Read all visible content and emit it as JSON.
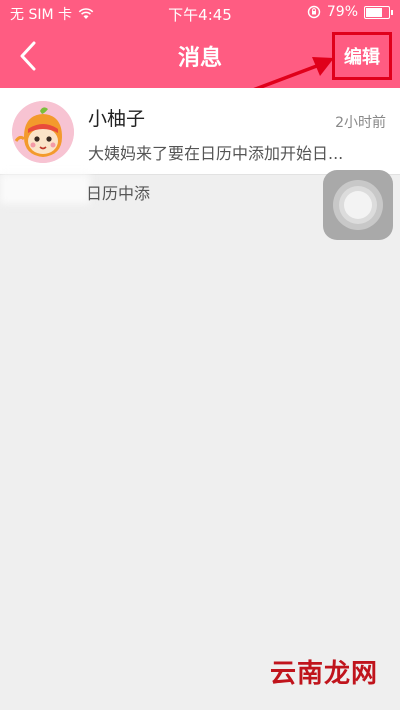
{
  "status_bar": {
    "carrier": "无 SIM 卡",
    "time": "下午4:45",
    "battery_percent": "79%",
    "battery_level": 0.79,
    "icons": [
      "wifi-icon",
      "lock-rotation-icon",
      "battery-icon"
    ]
  },
  "nav": {
    "title": "消息",
    "back_icon": "chevron-left-icon",
    "edit_label": "编辑"
  },
  "messages": [
    {
      "sender": "小柚子",
      "time": "2小时前",
      "preview": "大姨妈来了要在日历中添加开始日...",
      "avatar_icon": "pomelo-mascot-avatar"
    }
  ],
  "artifact_text": "日历中添",
  "watermark": "云南龙网",
  "colors": {
    "header": "#ff5c82",
    "annotation": "#e0001b",
    "background": "#efefef"
  }
}
